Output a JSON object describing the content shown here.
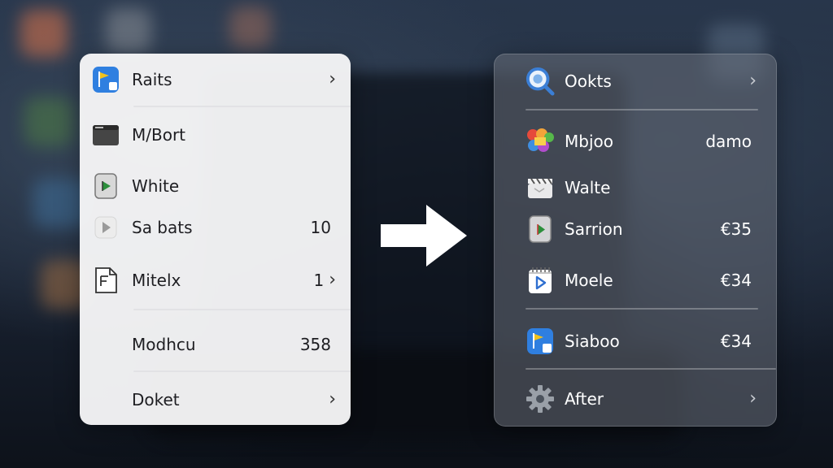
{
  "left_menu": {
    "items": [
      {
        "label": "Raits",
        "value": "",
        "icon": "flag-app-icon",
        "chevron": "›"
      },
      {
        "label": "M/Bort",
        "value": "",
        "icon": "window-icon",
        "chevron": ""
      },
      {
        "label": "White",
        "value": "",
        "icon": "play-document-icon",
        "chevron": ""
      },
      {
        "label": "Sa bats",
        "value": "10",
        "icon": "play-icon",
        "chevron": ""
      },
      {
        "label": "Mitelx",
        "value": "1",
        "icon": "document-icon",
        "chevron": "›"
      },
      {
        "label": "Modhcu",
        "value": "358",
        "icon": "",
        "chevron": ""
      },
      {
        "label": "Doket",
        "value": "",
        "icon": "",
        "chevron": "›"
      }
    ]
  },
  "right_menu": {
    "items": [
      {
        "label": "Ookts",
        "value": "",
        "icon": "search-icon",
        "chevron": "›"
      },
      {
        "label": "Mbjoo",
        "value": "damo",
        "icon": "photos-app-icon",
        "chevron": ""
      },
      {
        "label": "Walte",
        "value": "",
        "icon": "clapper-icon",
        "chevron": ""
      },
      {
        "label": "Sarrion",
        "value": "€35",
        "icon": "play-document-icon",
        "chevron": ""
      },
      {
        "label": "Moele",
        "value": "€34",
        "icon": "calendar-play-icon",
        "chevron": ""
      },
      {
        "label": "Siaboo",
        "value": "€34",
        "icon": "flag-app-icon",
        "chevron": ""
      },
      {
        "label": "After",
        "value": "",
        "icon": "gear-icon",
        "chevron": "›"
      }
    ]
  },
  "transition_arrow": {
    "icon": "right-arrow-icon"
  },
  "colors": {
    "left_panel": "#f6f6f7",
    "right_panel": "#686e78",
    "arrow": "#ffffff",
    "accent_blue": "#2f7fe0"
  }
}
